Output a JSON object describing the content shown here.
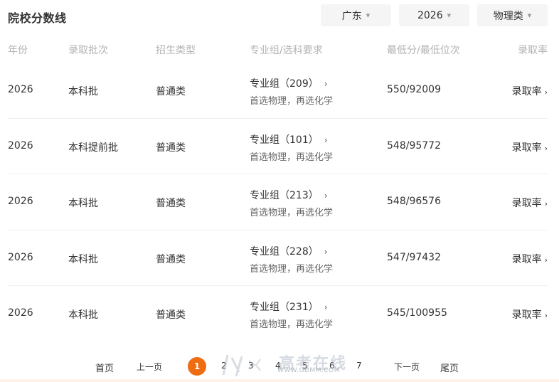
{
  "header": {
    "title": "院校分数线",
    "filters": {
      "province": "广东",
      "year": "2026",
      "subject": "物理类"
    }
  },
  "table": {
    "columns": {
      "year": "年份",
      "batch": "录取批次",
      "type": "招生类型",
      "group": "专业组/选科要求",
      "score": "最低分/最低位次",
      "rate": "录取率"
    },
    "rows": [
      {
        "year": "2026",
        "batch": "本科批",
        "type": "普通类",
        "group": "专业组（209）",
        "requirement": "首选物理，再选化学",
        "score": "550/92009",
        "rate": "录取率"
      },
      {
        "year": "2026",
        "batch": "本科提前批",
        "type": "普通类",
        "group": "专业组（101）",
        "requirement": "首选物理，再选化学",
        "score": "548/95772",
        "rate": "录取率"
      },
      {
        "year": "2026",
        "batch": "本科批",
        "type": "普通类",
        "group": "专业组（213）",
        "requirement": "首选物理，再选化学",
        "score": "548/96576",
        "rate": "录取率"
      },
      {
        "year": "2026",
        "batch": "本科批",
        "type": "普通类",
        "group": "专业组（228）",
        "requirement": "首选物理，再选化学",
        "score": "547/97432",
        "rate": "录取率"
      },
      {
        "year": "2026",
        "batch": "本科批",
        "type": "普通类",
        "group": "专业组（231）",
        "requirement": "首选物理，再选化学",
        "score": "545/100955",
        "rate": "录取率"
      }
    ]
  },
  "pagination": {
    "first": "首页",
    "prev": "上一页",
    "pages": [
      "1",
      "2",
      "3",
      "4",
      "5",
      "6",
      "7"
    ],
    "current": "1",
    "next": "下一页",
    "last": "尾页"
  },
  "watermark": {
    "text": "高考在线",
    "url": "WWW.GDMM.COM"
  },
  "colors": {
    "accent": "#f06c12",
    "header_text": "#b3b3b3",
    "filter_bg": "#f5f5f5"
  },
  "icons": {
    "dropdown": "caret-down-icon",
    "row_arrow": "chevron-right-icon"
  }
}
